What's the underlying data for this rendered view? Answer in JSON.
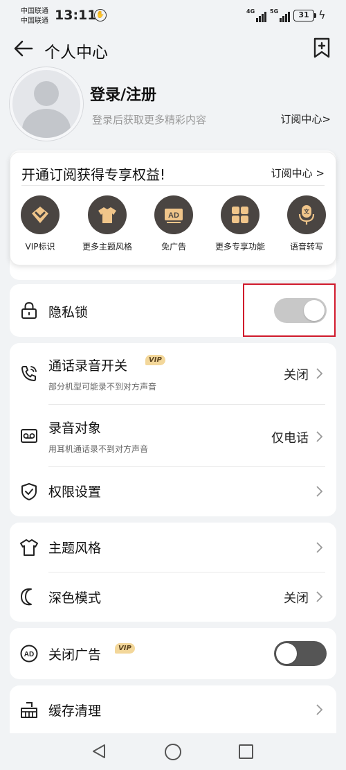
{
  "status_bar": {
    "carrier_1": "中国联通",
    "carrier_2": "中国联通",
    "time": "13:11",
    "network_1": "4G",
    "network_2": "5G",
    "battery": "31"
  },
  "header": {
    "title": "个人中心",
    "back_icon": "arrow-left-icon",
    "bookmark_icon": "bookmark-plus-icon"
  },
  "profile": {
    "login_title": "登录/注册",
    "login_subtitle": "登录后获取更多精彩内容",
    "subscription_link": "订阅中心>"
  },
  "subscription_popup": {
    "headline": "开通订阅获得专享权益!",
    "link": "订阅中心 >",
    "features": [
      {
        "label": "VIP标识",
        "icon": "vip-badge-icon"
      },
      {
        "label": "更多主题风格",
        "icon": "shirt-icon"
      },
      {
        "label": "免广告",
        "icon": "ad-icon"
      },
      {
        "label": "更多专享功能",
        "icon": "grid-icon"
      },
      {
        "label": "语音转写",
        "icon": "microphone-icon"
      }
    ]
  },
  "privacy_lock": {
    "title": "隐私锁",
    "icon": "lock-icon",
    "enabled": true
  },
  "recording_section": {
    "call_record": {
      "title": "通话录音开关",
      "badge": "VIP",
      "subtitle": "部分机型可能录不到对方声音",
      "value": "关闭",
      "icon": "phone-record-icon"
    },
    "record_target": {
      "title": "录音对象",
      "subtitle": "用耳机通话录不到对方声音",
      "value": "仅电话",
      "icon": "voicemail-icon"
    },
    "permissions": {
      "title": "权限设置",
      "icon": "shield-check-icon"
    }
  },
  "appearance_section": {
    "theme": {
      "title": "主题风格",
      "icon": "shirt-outline-icon"
    },
    "dark_mode": {
      "title": "深色模式",
      "value": "关闭",
      "icon": "moon-icon"
    }
  },
  "ads": {
    "title": "关闭广告",
    "badge": "VIP",
    "icon": "ad-circle-icon",
    "enabled": false
  },
  "cache": {
    "title": "缓存清理",
    "icon": "broom-icon"
  },
  "colors": {
    "toggle_on": "#c8c8c8",
    "toggle_off": "#555555",
    "feature_circle": "#4a4542",
    "feature_glyph": "#f0c58a",
    "highlight_box": "#d0192b"
  }
}
